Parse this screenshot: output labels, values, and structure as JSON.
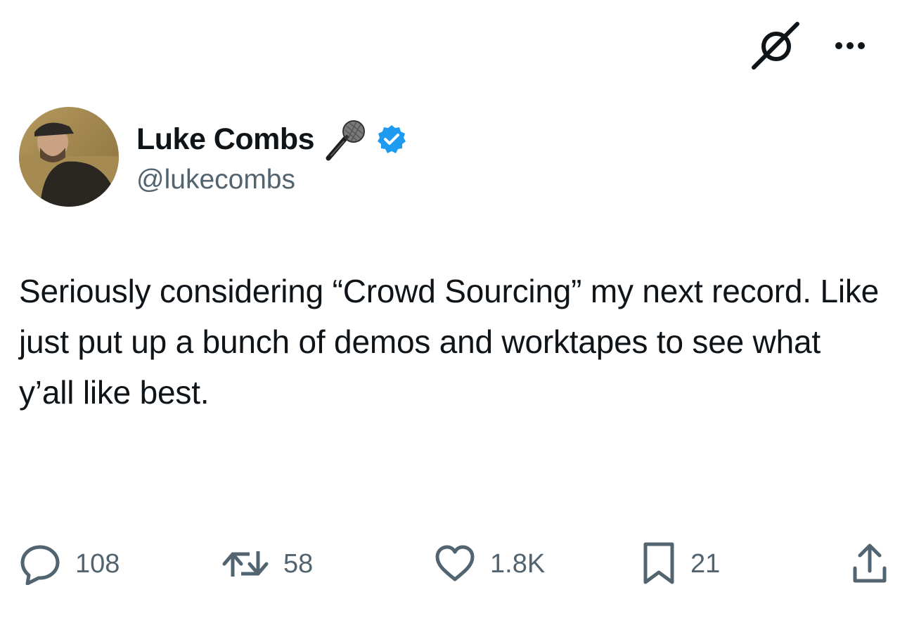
{
  "tweet": {
    "display_name": "Luke Combs",
    "handle": "@lukecombs",
    "text": "Seriously considering “Crowd Sourcing” my next record. Like just put up a bunch of demos and worktapes to see what y’all like best."
  },
  "icons": {
    "top_right": [
      "grok-icon",
      "more-icon"
    ],
    "name_emoji": "microphone-icon",
    "badge": "verified-icon",
    "actions": [
      "reply-icon",
      "repost-icon",
      "like-icon",
      "bookmark-icon",
      "share-icon"
    ]
  },
  "metrics": {
    "replies": "108",
    "reposts": "58",
    "likes": "1.8K",
    "bookmarks": "21"
  },
  "colors": {
    "text": "#0f1419",
    "secondary": "#536471",
    "verified": "#1d9bf0"
  }
}
